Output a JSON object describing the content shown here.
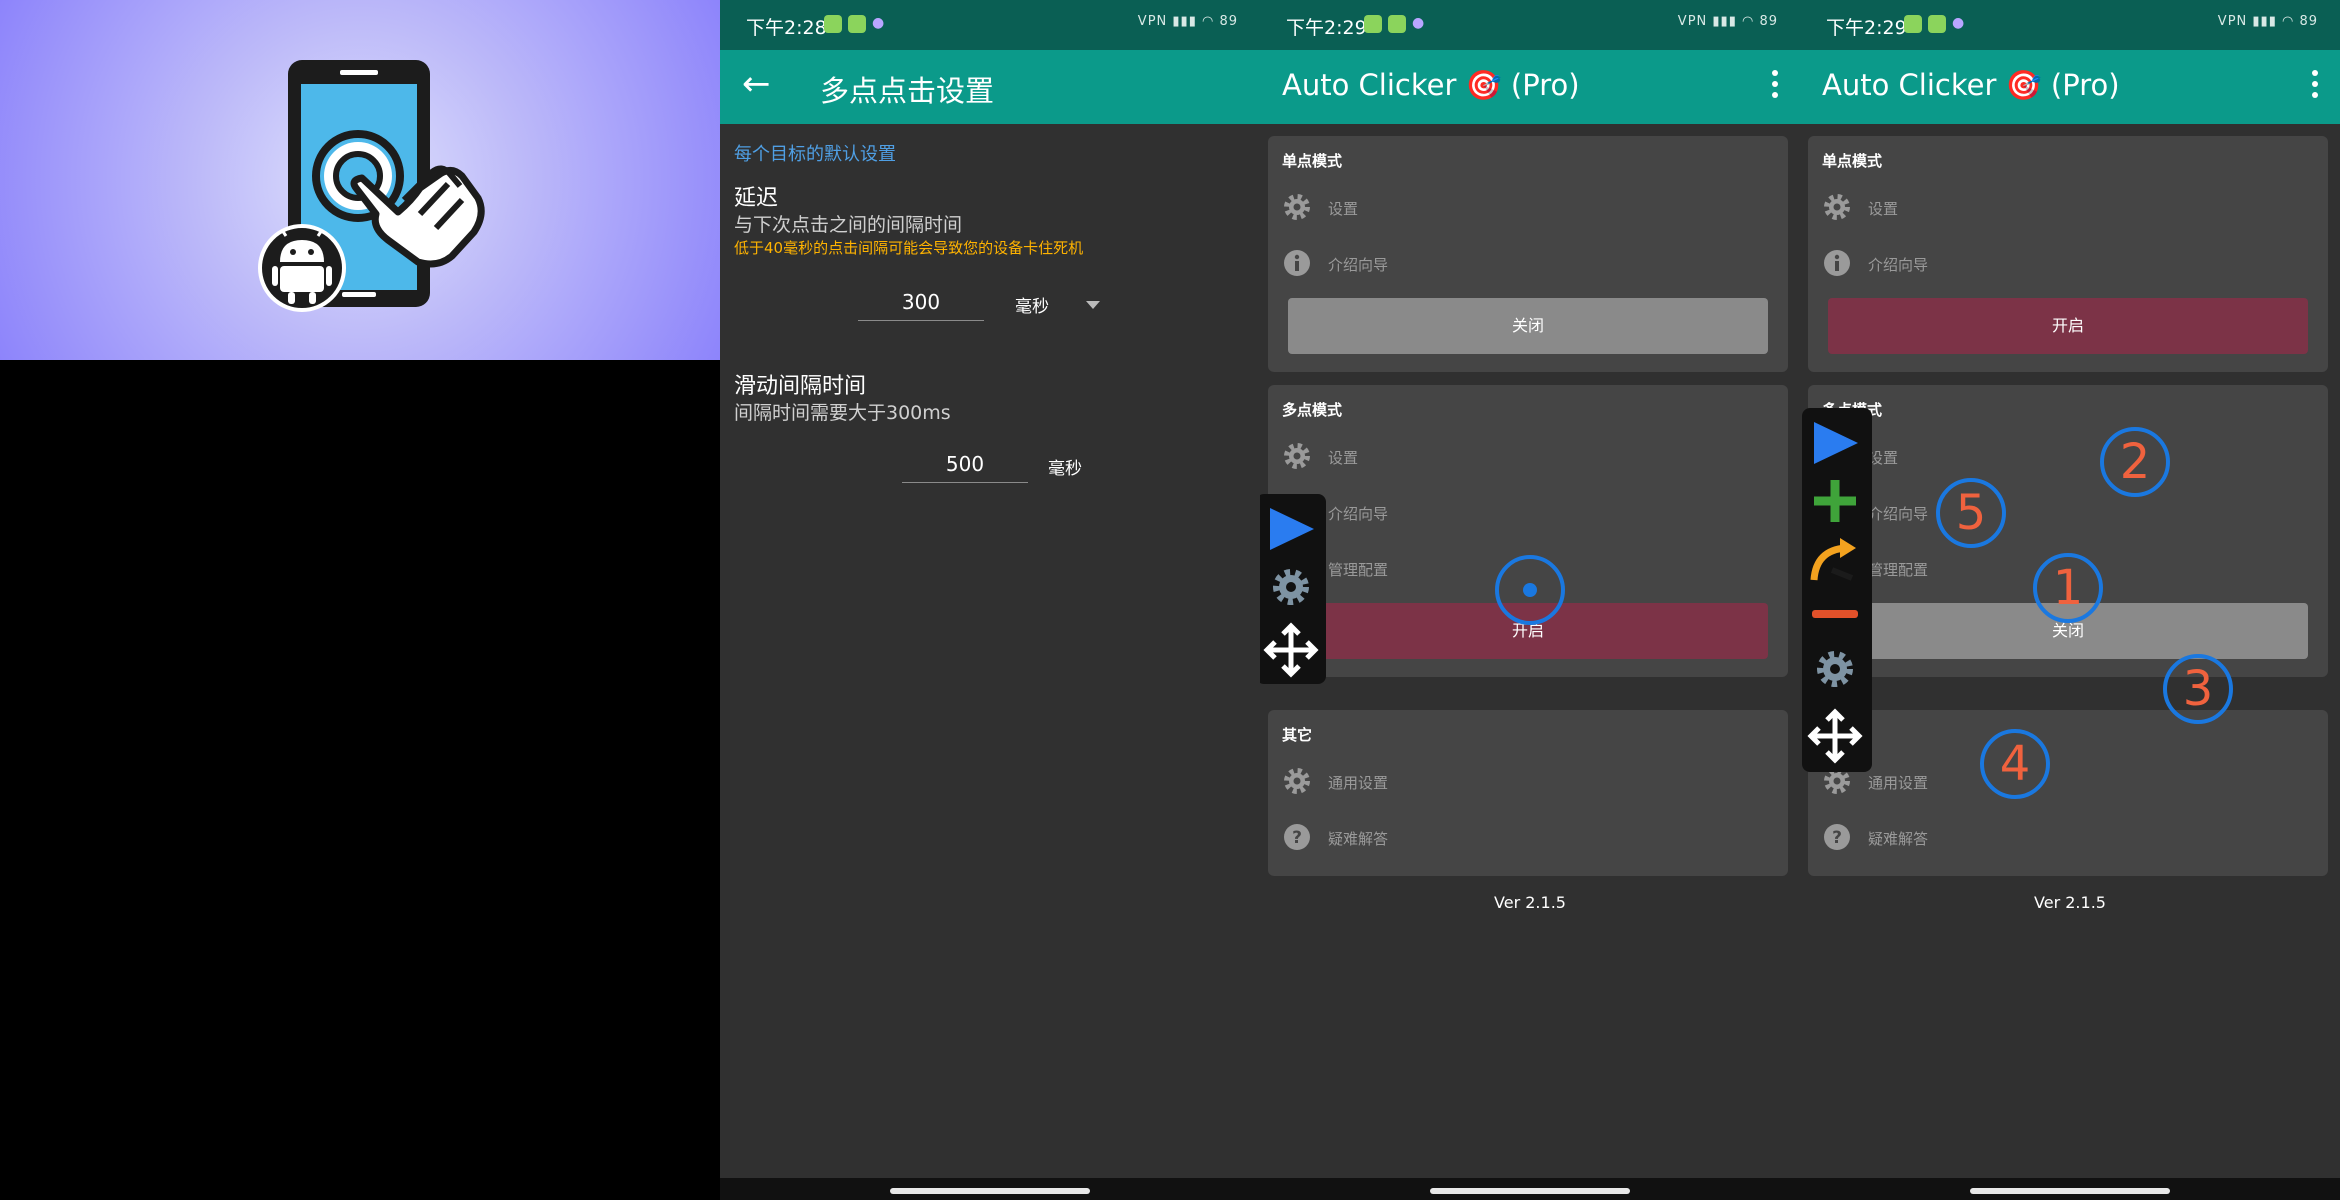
{
  "status": {
    "time1": "下午2:28",
    "time2": "下午2:29",
    "time3": "下午2:29",
    "right": "VPN ▮▮▮ ◠ 89"
  },
  "settings": {
    "title": "多点点击设置",
    "section": "每个目标的默认设置",
    "delay_title": "延迟",
    "delay_desc": "与下次点击之间的间隔时间",
    "delay_warn": "低于40毫秒的点击间隔可能会导致您的设备卡住死机",
    "delay_value": "300",
    "delay_unit": "毫秒",
    "swipe_title": "滑动间隔时间",
    "swipe_desc": "间隔时间需要大于300ms",
    "swipe_value": "500",
    "swipe_unit": "毫秒"
  },
  "home": {
    "title": "Auto Clicker 🎯 (Pro)",
    "single": {
      "title": "单点模式",
      "settings": "设置",
      "intro": "介绍向导",
      "btn_off": "关闭",
      "btn_on": "开启"
    },
    "multi": {
      "title": "多点模式",
      "settings": "设置",
      "intro": "介绍向导",
      "manage": "管理配置",
      "btn_on": "开启",
      "btn_off": "关闭"
    },
    "other": {
      "title": "其它",
      "general": "通用设置",
      "faq": "疑难解答"
    },
    "version": "Ver 2.1.5"
  },
  "targets": [
    "1",
    "2",
    "3",
    "4",
    "5"
  ],
  "colors": {
    "status_bar": "#0a5f54",
    "toolbar": "#0b9a8a",
    "play": "#2a7cf0",
    "add": "#3fa43a",
    "swipe": "#f3a21f",
    "remove": "#e2512a",
    "target": "#1a78e0",
    "target_number": "#f0623e"
  },
  "icons": [
    "back-arrow-icon",
    "kebab-menu-icon",
    "gear-icon",
    "info-icon",
    "help-icon",
    "play-icon",
    "plus-icon",
    "swipe-arrow-icon",
    "minus-icon",
    "move-icon",
    "android-icon",
    "hand-pointer-icon"
  ]
}
